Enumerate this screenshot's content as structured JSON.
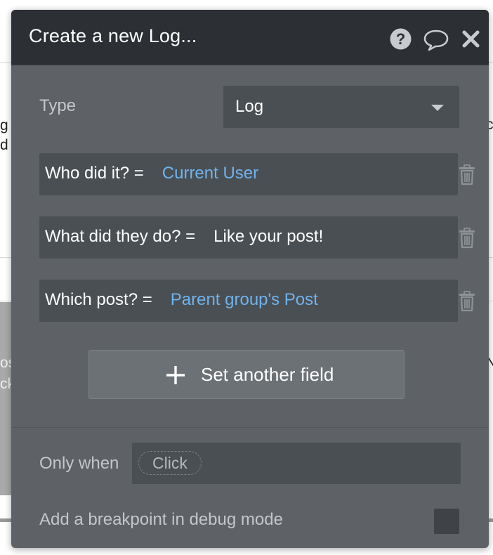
{
  "modal": {
    "title": "Create a new Log...",
    "icons": [
      "help-icon",
      "comment-icon",
      "close-icon"
    ],
    "type_label": "Type",
    "type_value": "Log",
    "fields": [
      {
        "label": "Who did it?",
        "eq": "=",
        "value": "Current User",
        "kind": "dynamic"
      },
      {
        "label": "What did they do?",
        "eq": "=",
        "value": "Like your post!",
        "kind": "static"
      },
      {
        "label": "Which post?",
        "eq": "=",
        "value": "Parent group's Post",
        "kind": "dynamic"
      }
    ],
    "set_field_label": "Set another field",
    "only_when_label": "Only when",
    "only_when_placeholder": "Click",
    "breakpoint_label": "Add a breakpoint in debug mode",
    "colors": {
      "header": "#2c3034",
      "body": "#5e6266",
      "field": "#4a4f53",
      "dynamic_text": "#6fb3ef"
    }
  },
  "background": {
    "fragments": [
      "g",
      "d",
      "os",
      "ck",
      "c",
      "N"
    ]
  }
}
